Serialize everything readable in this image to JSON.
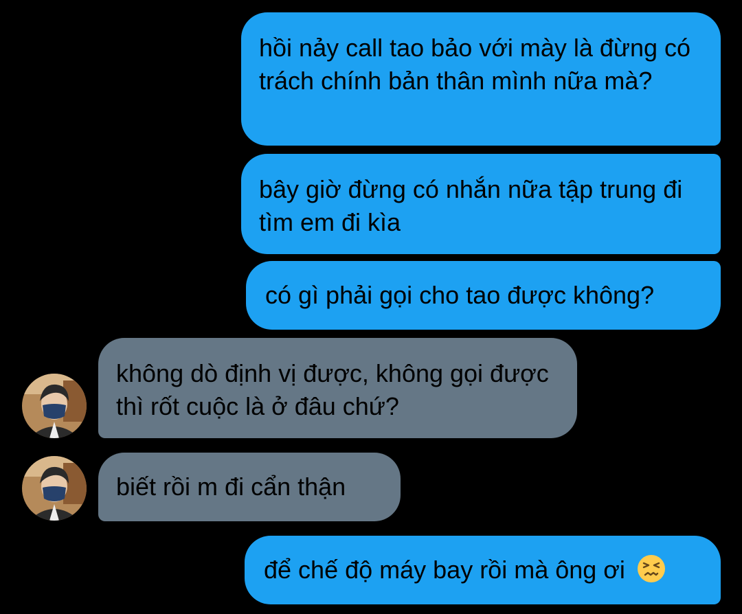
{
  "conversation": {
    "messages": [
      {
        "direction": "sent",
        "text": "hồi nảy call tao bảo với mày là đừng có trách chính bản thân mình nữa mà?"
      },
      {
        "direction": "sent",
        "text": "bây giờ đừng có nhắn nữa tập trung đi tìm em đi kìa"
      },
      {
        "direction": "sent",
        "text": "có gì phải gọi cho tao được không?"
      },
      {
        "direction": "received",
        "text": "không dò định vị được, không gọi được thì rốt cuộc là ở đâu chứ?"
      },
      {
        "direction": "received",
        "text": "biết rồi m đi cẩn thận"
      },
      {
        "direction": "sent",
        "text": "để chế độ máy bay rồi mà ông ơi",
        "emoji": "persevering-face-emoji"
      }
    ]
  },
  "colors": {
    "background": "#000000",
    "sent_bubble": "#1da1f2",
    "received_bubble": "#657786",
    "text": "#000000"
  }
}
